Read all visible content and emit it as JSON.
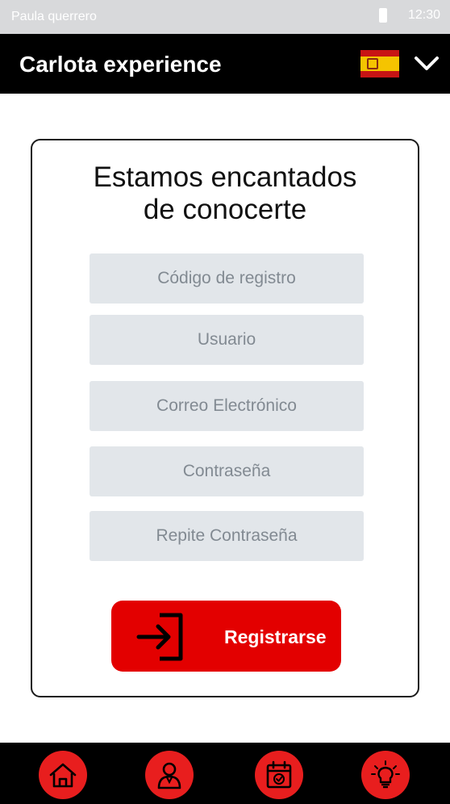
{
  "status_bar": {
    "user_name": "Paula querrero",
    "time": "12:30"
  },
  "header": {
    "title": "Carlota experience",
    "language_flag": "spain-flag-icon",
    "menu_icon": "chevron-down-icon"
  },
  "card": {
    "title_line1": "Estamos encantados",
    "title_line2": "de conocerte",
    "fields": {
      "registration_code": {
        "placeholder": "Código de registro",
        "value": ""
      },
      "username": {
        "placeholder": "Usuario",
        "value": ""
      },
      "email": {
        "placeholder": "Correo Electrónico",
        "value": ""
      },
      "password": {
        "placeholder": "Contraseña",
        "value": ""
      },
      "repeat_password": {
        "placeholder": "Repite Contraseña",
        "value": ""
      }
    },
    "register_button": {
      "label": "Registrarse",
      "icon": "login-icon"
    }
  },
  "bottom_nav": {
    "items": [
      {
        "icon": "home-icon"
      },
      {
        "icon": "user-icon"
      },
      {
        "icon": "calendar-check-icon"
      },
      {
        "icon": "lightbulb-icon"
      }
    ]
  },
  "colors": {
    "accent": "#e30000",
    "nav_icon_bg": "#e81e1e",
    "header_bg": "#000000",
    "field_bg": "#e2e6ea",
    "status_bar_bg": "#d8d9db"
  }
}
